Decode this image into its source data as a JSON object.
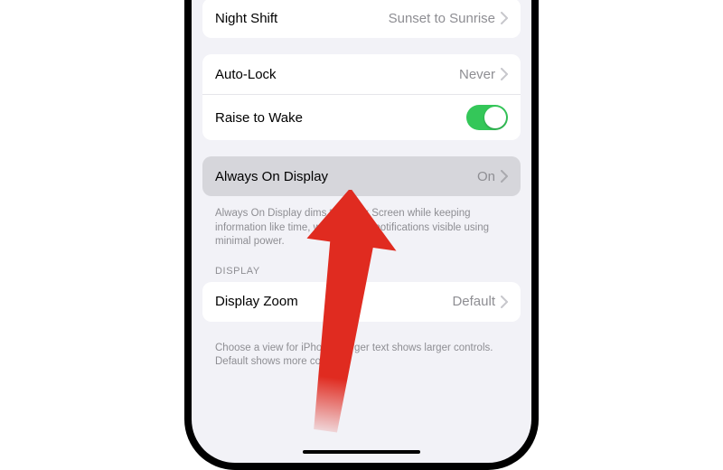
{
  "nightShift": {
    "label": "Night Shift",
    "value": "Sunset to Sunrise"
  },
  "autoLock": {
    "label": "Auto-Lock",
    "value": "Never"
  },
  "raiseToWake": {
    "label": "Raise to Wake"
  },
  "alwaysOn": {
    "label": "Always On Display",
    "value": "On"
  },
  "alwaysOnFooter": "Always On Display dims the Lock Screen while keeping information like time, widgets, and notifications visible using minimal power.",
  "displayHeader": "DISPLAY",
  "displayZoom": {
    "label": "Display Zoom",
    "value": "Default"
  },
  "displayZoomFooter": "Choose a view for iPhone. Larger text shows larger controls. Default shows more content."
}
